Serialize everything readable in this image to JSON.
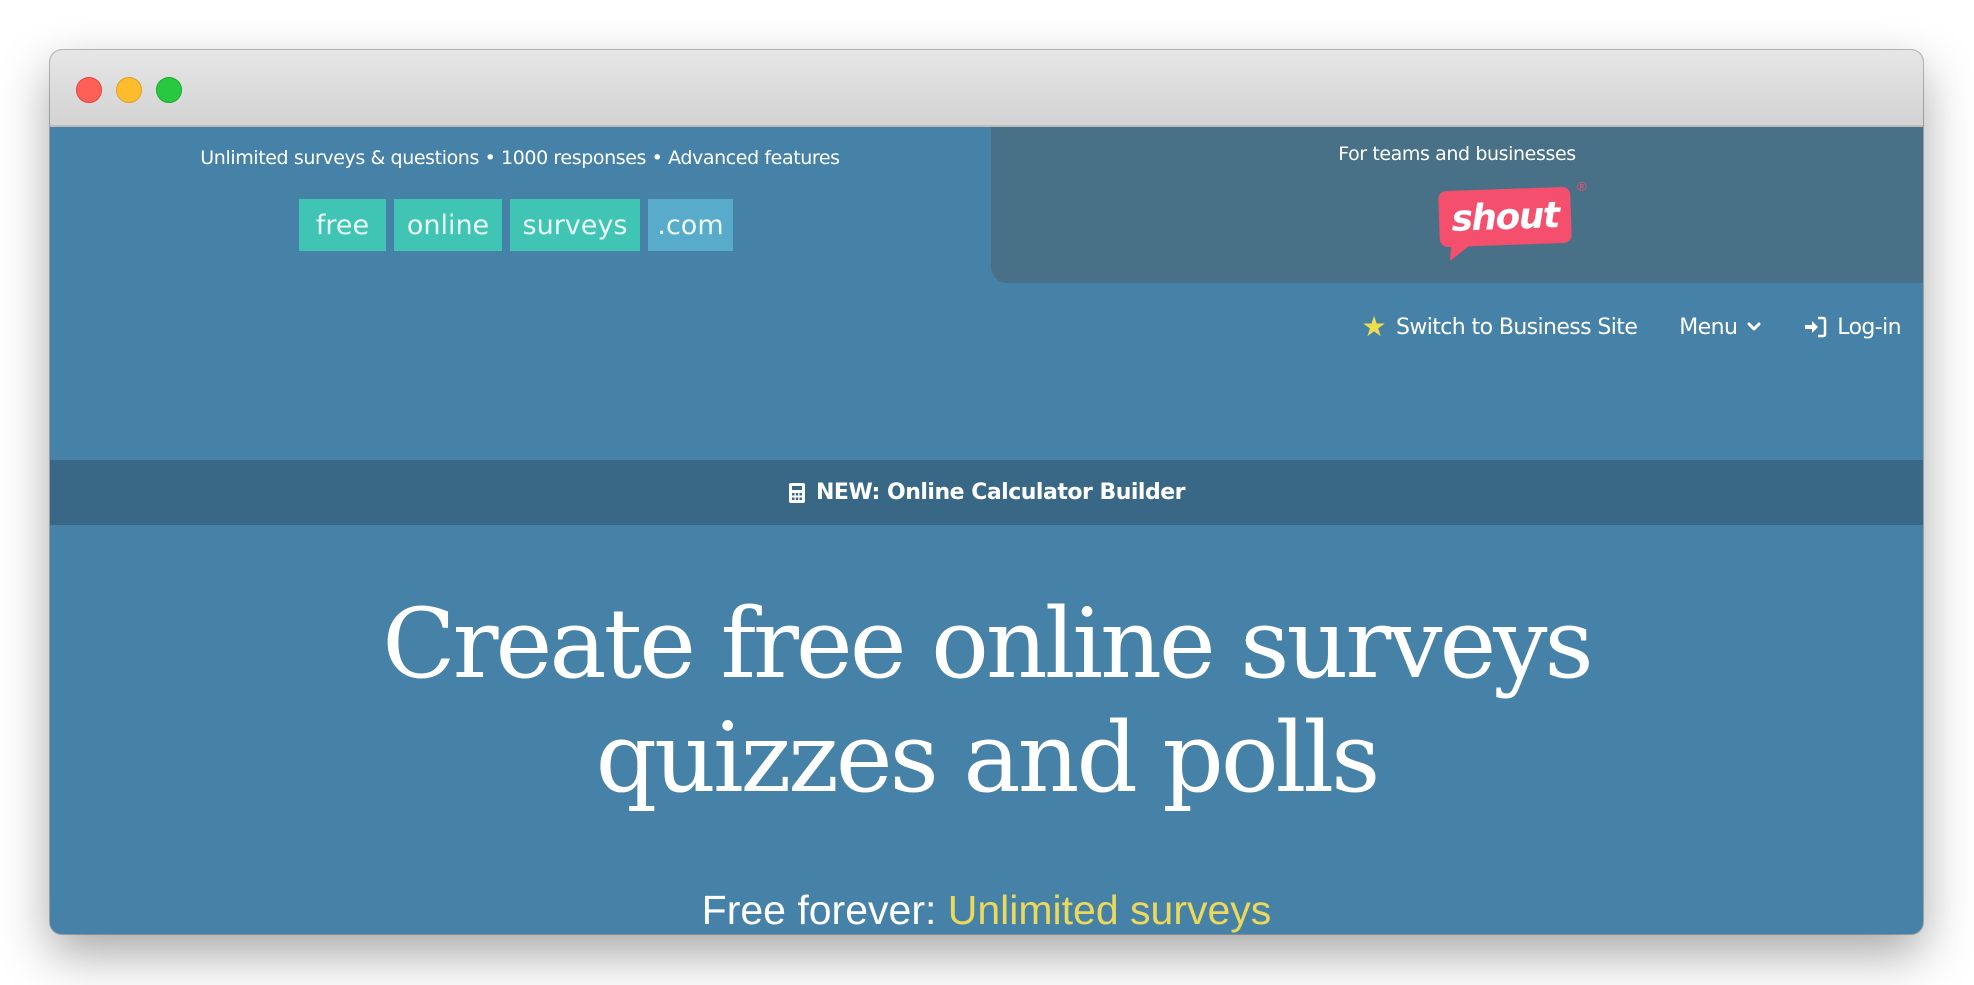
{
  "window": {
    "controls": [
      "close",
      "minimize",
      "maximize"
    ]
  },
  "header": {
    "tagline": "Unlimited surveys & questions • 1000 responses • Advanced features",
    "logo": {
      "parts": [
        "free",
        "online",
        "surveys",
        ".com"
      ]
    },
    "business_panel": {
      "text": "For teams and businesses",
      "brand": "shout",
      "registered_mark": "®"
    }
  },
  "nav": {
    "items": [
      {
        "label": "Switch to Business Site",
        "icon": "star-icon"
      },
      {
        "label": "Menu",
        "icon": "chevron-down-icon"
      },
      {
        "label": "Log-in",
        "icon": "sign-in-icon"
      }
    ]
  },
  "announcement": {
    "icon": "calculator-icon",
    "label": "NEW: Online Calculator Builder"
  },
  "hero": {
    "title_line1": "Create free online surveys",
    "title_line2": "quizzes and polls",
    "subtitle_prefix": "Free forever: ",
    "subtitle_highlight": "Unlimited surveys"
  },
  "colors": {
    "page_bg": "#4682a8",
    "business_panel_bg": "#487087",
    "announcement_bg": "#386886",
    "logo_teal": "#40c4b4",
    "logo_blue": "#58abcb",
    "shout_pink": "#f44f6c",
    "highlight_yellow": "#ecd85a",
    "star_yellow": "#f0dc4e"
  }
}
